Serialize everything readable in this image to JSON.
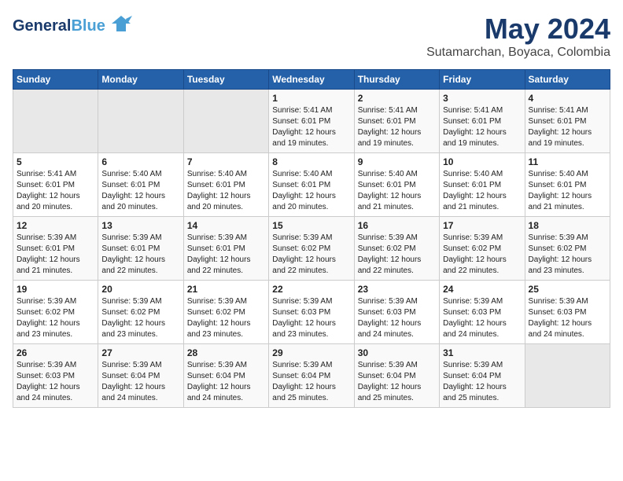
{
  "header": {
    "logo_general": "General",
    "logo_blue": "Blue",
    "title": "May 2024",
    "subtitle": "Sutamarchan, Boyaca, Colombia"
  },
  "days_of_week": [
    "Sunday",
    "Monday",
    "Tuesday",
    "Wednesday",
    "Thursday",
    "Friday",
    "Saturday"
  ],
  "weeks": [
    [
      {
        "day": "",
        "info": ""
      },
      {
        "day": "",
        "info": ""
      },
      {
        "day": "",
        "info": ""
      },
      {
        "day": "1",
        "info": "Sunrise: 5:41 AM\nSunset: 6:01 PM\nDaylight: 12 hours\nand 19 minutes."
      },
      {
        "day": "2",
        "info": "Sunrise: 5:41 AM\nSunset: 6:01 PM\nDaylight: 12 hours\nand 19 minutes."
      },
      {
        "day": "3",
        "info": "Sunrise: 5:41 AM\nSunset: 6:01 PM\nDaylight: 12 hours\nand 19 minutes."
      },
      {
        "day": "4",
        "info": "Sunrise: 5:41 AM\nSunset: 6:01 PM\nDaylight: 12 hours\nand 19 minutes."
      }
    ],
    [
      {
        "day": "5",
        "info": "Sunrise: 5:41 AM\nSunset: 6:01 PM\nDaylight: 12 hours\nand 20 minutes."
      },
      {
        "day": "6",
        "info": "Sunrise: 5:40 AM\nSunset: 6:01 PM\nDaylight: 12 hours\nand 20 minutes."
      },
      {
        "day": "7",
        "info": "Sunrise: 5:40 AM\nSunset: 6:01 PM\nDaylight: 12 hours\nand 20 minutes."
      },
      {
        "day": "8",
        "info": "Sunrise: 5:40 AM\nSunset: 6:01 PM\nDaylight: 12 hours\nand 20 minutes."
      },
      {
        "day": "9",
        "info": "Sunrise: 5:40 AM\nSunset: 6:01 PM\nDaylight: 12 hours\nand 21 minutes."
      },
      {
        "day": "10",
        "info": "Sunrise: 5:40 AM\nSunset: 6:01 PM\nDaylight: 12 hours\nand 21 minutes."
      },
      {
        "day": "11",
        "info": "Sunrise: 5:40 AM\nSunset: 6:01 PM\nDaylight: 12 hours\nand 21 minutes."
      }
    ],
    [
      {
        "day": "12",
        "info": "Sunrise: 5:39 AM\nSunset: 6:01 PM\nDaylight: 12 hours\nand 21 minutes."
      },
      {
        "day": "13",
        "info": "Sunrise: 5:39 AM\nSunset: 6:01 PM\nDaylight: 12 hours\nand 22 minutes."
      },
      {
        "day": "14",
        "info": "Sunrise: 5:39 AM\nSunset: 6:01 PM\nDaylight: 12 hours\nand 22 minutes."
      },
      {
        "day": "15",
        "info": "Sunrise: 5:39 AM\nSunset: 6:02 PM\nDaylight: 12 hours\nand 22 minutes."
      },
      {
        "day": "16",
        "info": "Sunrise: 5:39 AM\nSunset: 6:02 PM\nDaylight: 12 hours\nand 22 minutes."
      },
      {
        "day": "17",
        "info": "Sunrise: 5:39 AM\nSunset: 6:02 PM\nDaylight: 12 hours\nand 22 minutes."
      },
      {
        "day": "18",
        "info": "Sunrise: 5:39 AM\nSunset: 6:02 PM\nDaylight: 12 hours\nand 23 minutes."
      }
    ],
    [
      {
        "day": "19",
        "info": "Sunrise: 5:39 AM\nSunset: 6:02 PM\nDaylight: 12 hours\nand 23 minutes."
      },
      {
        "day": "20",
        "info": "Sunrise: 5:39 AM\nSunset: 6:02 PM\nDaylight: 12 hours\nand 23 minutes."
      },
      {
        "day": "21",
        "info": "Sunrise: 5:39 AM\nSunset: 6:02 PM\nDaylight: 12 hours\nand 23 minutes."
      },
      {
        "day": "22",
        "info": "Sunrise: 5:39 AM\nSunset: 6:03 PM\nDaylight: 12 hours\nand 23 minutes."
      },
      {
        "day": "23",
        "info": "Sunrise: 5:39 AM\nSunset: 6:03 PM\nDaylight: 12 hours\nand 24 minutes."
      },
      {
        "day": "24",
        "info": "Sunrise: 5:39 AM\nSunset: 6:03 PM\nDaylight: 12 hours\nand 24 minutes."
      },
      {
        "day": "25",
        "info": "Sunrise: 5:39 AM\nSunset: 6:03 PM\nDaylight: 12 hours\nand 24 minutes."
      }
    ],
    [
      {
        "day": "26",
        "info": "Sunrise: 5:39 AM\nSunset: 6:03 PM\nDaylight: 12 hours\nand 24 minutes."
      },
      {
        "day": "27",
        "info": "Sunrise: 5:39 AM\nSunset: 6:04 PM\nDaylight: 12 hours\nand 24 minutes."
      },
      {
        "day": "28",
        "info": "Sunrise: 5:39 AM\nSunset: 6:04 PM\nDaylight: 12 hours\nand 24 minutes."
      },
      {
        "day": "29",
        "info": "Sunrise: 5:39 AM\nSunset: 6:04 PM\nDaylight: 12 hours\nand 25 minutes."
      },
      {
        "day": "30",
        "info": "Sunrise: 5:39 AM\nSunset: 6:04 PM\nDaylight: 12 hours\nand 25 minutes."
      },
      {
        "day": "31",
        "info": "Sunrise: 5:39 AM\nSunset: 6:04 PM\nDaylight: 12 hours\nand 25 minutes."
      },
      {
        "day": "",
        "info": ""
      }
    ]
  ]
}
